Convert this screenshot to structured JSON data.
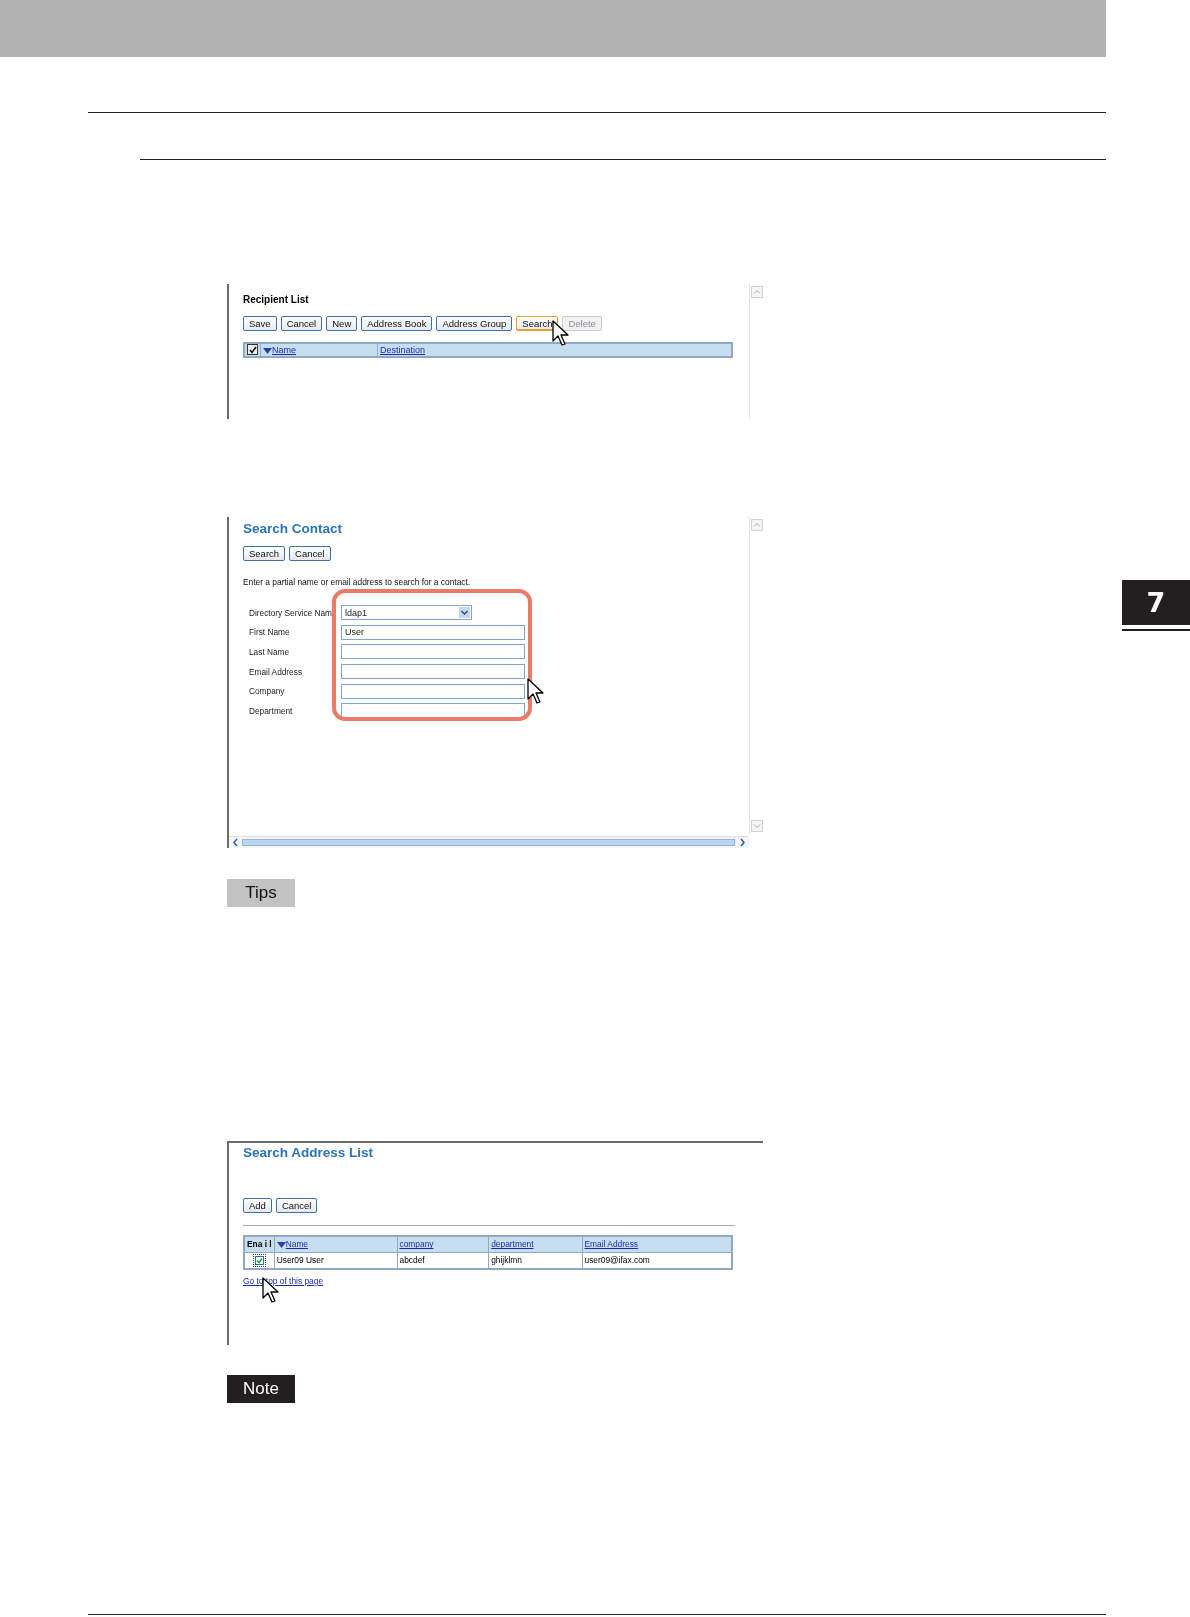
{
  "chapter_tab": "7",
  "blocks": [
    {
      "kind": "recipient_list",
      "title": "Recipient List",
      "buttons": [
        {
          "label": "Save",
          "focused": false,
          "disabled": false
        },
        {
          "label": "Cancel",
          "focused": false,
          "disabled": false
        },
        {
          "label": "New",
          "focused": false,
          "disabled": false
        },
        {
          "label": "Address Book",
          "focused": false,
          "disabled": false
        },
        {
          "label": "Address Group",
          "focused": false,
          "disabled": false
        },
        {
          "label": "Search",
          "focused": true,
          "disabled": false
        },
        {
          "label": "Delete",
          "focused": false,
          "disabled": true
        }
      ],
      "select_all_checked": true,
      "columns": [
        {
          "label": "Name",
          "sorted": true
        },
        {
          "label": "Destination",
          "sorted": false
        }
      ]
    },
    {
      "kind": "search_contact",
      "title": "Search Contact",
      "buttons": [
        {
          "label": "Search",
          "focused": false,
          "disabled": false
        },
        {
          "label": "Cancel",
          "focused": false,
          "disabled": false
        }
      ],
      "instruction": "Enter a partial name or email address to search for a contact.",
      "fields": [
        {
          "label": "Directory Service Nam",
          "kind": "select",
          "value": "ldap1"
        },
        {
          "label": "First Name",
          "kind": "text",
          "value": "User"
        },
        {
          "label": "Last Name",
          "kind": "text"
        },
        {
          "label": "Email Address",
          "kind": "text"
        },
        {
          "label": "Company",
          "kind": "text"
        },
        {
          "label": "Department",
          "kind": "text"
        }
      ]
    },
    {
      "kind": "tips",
      "label": "Tips"
    },
    {
      "kind": "search_results",
      "title": "Search Address List",
      "buttons": [
        {
          "label": "Add",
          "focused": false,
          "disabled": false
        },
        {
          "label": "Cancel",
          "focused": false,
          "disabled": false
        }
      ],
      "columns": [
        {
          "label": "Ena i l",
          "sorted": false
        },
        {
          "label": "Name",
          "sorted": true
        },
        {
          "label": "company",
          "sorted": false
        },
        {
          "label": "department",
          "sorted": false
        },
        {
          "label": "Email Address",
          "sorted": false
        }
      ],
      "rows": [
        {
          "checked": true,
          "cells": [
            "",
            "User09 User",
            "abcdef",
            "ghijklmn",
            "user09@ifax.com"
          ]
        }
      ],
      "link": "Go to top of this page"
    },
    {
      "kind": "note",
      "label": "Note"
    }
  ]
}
